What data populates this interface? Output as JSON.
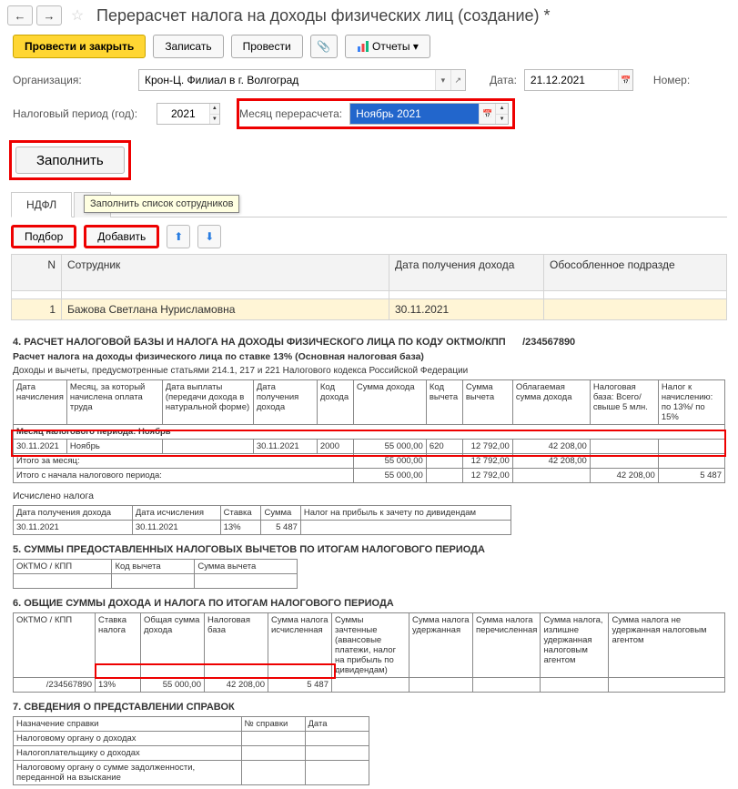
{
  "header": {
    "title": "Перерасчет налога на доходы физических лиц (создание) *"
  },
  "actions": {
    "post_close": "Провести и закрыть",
    "save": "Записать",
    "post": "Провести",
    "reports": "Отчеты"
  },
  "form": {
    "org_label": "Организация:",
    "org_value": "Крон-Ц. Филиал в г. Волгоград",
    "date_label": "Дата:",
    "date_value": "21.12.2021",
    "number_label": "Номер:",
    "period_label": "Налоговый период (год):",
    "period_value": "2021",
    "month_label": "Месяц перерасчета:",
    "month_value": "Ноябрь 2021"
  },
  "fill_btn": "Заполнить",
  "tabs": {
    "ndfl": "НДФЛ",
    "k": "К",
    "tooltip": "Заполнить список сотрудников"
  },
  "subtoolbar": {
    "pick": "Подбор",
    "add": "Добавить"
  },
  "grid": {
    "cols": {
      "n": "N",
      "emp": "Сотрудник",
      "date": "Дата получения дохода",
      "dep": "Обособленное подразде"
    },
    "rows": [
      {
        "n": "1",
        "emp": "Бажова Светлана Нурисламовна",
        "date": "30.11.2021",
        "dep": ""
      }
    ]
  },
  "sec4": {
    "title": "4. РАСЧЕТ НАЛОГОВОЙ БАЗЫ И НАЛОГА НА ДОХОДЫ ФИЗИЧЕСКОГО ЛИЦА ПО КОДУ ОКТМО/КПП",
    "kpp": "/234567890",
    "sub": "Расчет налога на доходы физического лица по ставке 13% (Основная налоговая база)",
    "note": "Доходы и вычеты, предусмотренные статьями 214.1, 217 и 221 Налогового кодекса Российской Федерации",
    "head": [
      "Дата начисления",
      "Месяц, за который начислена оплата труда",
      "Дата выплаты (передачи дохода в натуральной форме)",
      "Дата получения дохода",
      "Код дохода",
      "Сумма дохода",
      "Код вычета",
      "Сумма вычета",
      "Облагаемая сумма дохода",
      "Налоговая база: Всего/ свыше 5 млн.",
      "Налог к начислению: по 13%/ по 15%"
    ],
    "monthrow": "Месяц налогового периода: Ноябрь",
    "row": {
      "d1": "30.11.2021",
      "m": "Ноябрь",
      "d3": "",
      "d4": "30.11.2021",
      "code": "2000",
      "sum": "55 000,00",
      "vcode": "620",
      "vsum": "12 792,00",
      "base": "42 208,00",
      "nb": "",
      "tax": ""
    },
    "total_month": {
      "label": "Итого за месяц:",
      "sum": "55 000,00",
      "vsum": "12 792,00",
      "base": "42 208,00"
    },
    "total_all": {
      "label": "Итого с начала налогового периода:",
      "sum": "55 000,00",
      "vsum": "12 792,00",
      "base": "42 208,00",
      "nbase": "42 208,00",
      "tax": "5 487"
    },
    "calc_label": "Исчислено налога",
    "calc_head": [
      "Дата получения дохода",
      "Дата исчисления",
      "Ставка",
      "Сумма",
      "Налог на прибыль к зачету по дивидендам"
    ],
    "calc_row": {
      "d1": "30.11.2021",
      "d2": "30.11.2021",
      "rate": "13%",
      "sum": "5 487",
      "div": ""
    }
  },
  "sec5": {
    "title": "5. СУММЫ ПРЕДОСТАВЛЕННЫХ НАЛОГОВЫХ ВЫЧЕТОВ ПО ИТОГАМ НАЛОГОВОГО ПЕРИОДА",
    "head": [
      "ОКТМО / КПП",
      "Код вычета",
      "Сумма вычета"
    ]
  },
  "sec6": {
    "title": "6. ОБЩИЕ СУММЫ ДОХОДА И НАЛОГА ПО ИТОГАМ НАЛОГОВОГО ПЕРИОДА",
    "head": [
      "ОКТМО / КПП",
      "Ставка налога",
      "Общая сумма дохода",
      "Налоговая база",
      "Сумма налога исчисленная",
      "Суммы зачтенные (авансовые платежи, налог на прибыль по дивидендам)",
      "Сумма налога удержанная",
      "Сумма налога перечисленная",
      "Сумма налога, излишне удержанная налоговым агентом",
      "Сумма налога не удержанная налоговым агентом"
    ],
    "row": {
      "okt": "/234567890",
      "rate": "13%",
      "sum": "55 000,00",
      "base": "42 208,00",
      "tax": "5 487"
    }
  },
  "sec7": {
    "title": "7. СВЕДЕНИЯ О ПРЕДСТАВЛЕНИИ СПРАВОК",
    "head": [
      "Назначение справки",
      "№ справки",
      "Дата"
    ],
    "rows": [
      "Налоговому органу о доходах",
      "Налогоплательщику о доходах",
      "Налоговому органу о сумме задолженности, переданной на взыскание"
    ]
  }
}
